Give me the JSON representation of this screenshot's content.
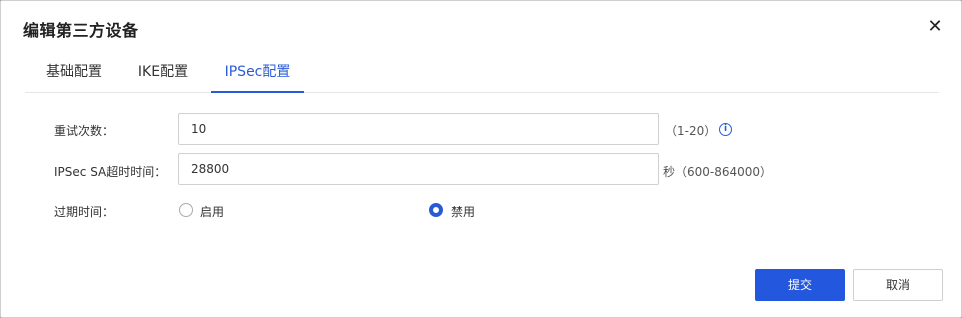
{
  "dialog": {
    "title": "编辑第三方设备",
    "close_symbol": "✕"
  },
  "tabs": [
    {
      "label": "基础配置",
      "active": false
    },
    {
      "label": "IKE配置",
      "active": false
    },
    {
      "label": "IPSec配置",
      "active": true
    }
  ],
  "form": {
    "retry": {
      "label": "重试次数：",
      "value": "10",
      "hint": "（1-20）"
    },
    "sa_timeout": {
      "label": "IPSec SA超时时间：",
      "value": "28800",
      "hint": "秒（600-864000）"
    },
    "expire": {
      "label": "过期时间：",
      "options": [
        {
          "label": "启用",
          "checked": false
        },
        {
          "label": "禁用",
          "checked": true
        }
      ]
    }
  },
  "buttons": {
    "submit": "提交",
    "cancel": "取消"
  },
  "colors": {
    "accent": "#2a5bd7",
    "primary_button": "#2357dd"
  },
  "icons": {
    "close": "close-icon",
    "info": "info-icon"
  }
}
